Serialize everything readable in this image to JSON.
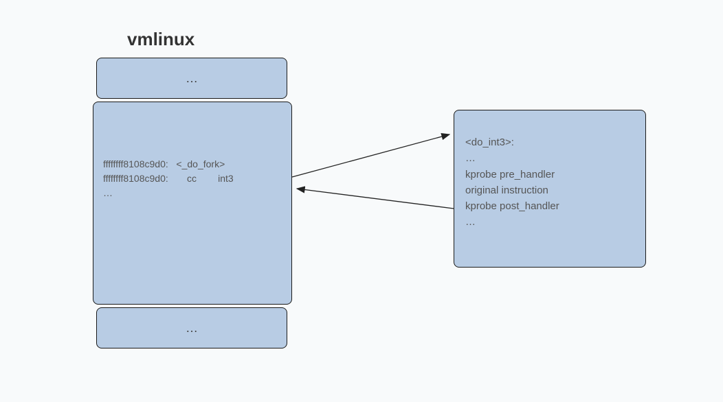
{
  "title": "vmlinux",
  "left": {
    "top_ellipsis": "…",
    "middle": {
      "line1": "ffffffff8108c9d0:   <_do_fork>",
      "line2": "ffffffff8108c9d0:       cc        int3",
      "line3": "…"
    },
    "bottom_ellipsis": "…"
  },
  "right": {
    "line1": "<do_int3>:",
    "line2": "…",
    "line3": "kprobe pre_handler",
    "line4": "original instruction",
    "line5": "kprobe post_handler",
    "line6": "…"
  }
}
